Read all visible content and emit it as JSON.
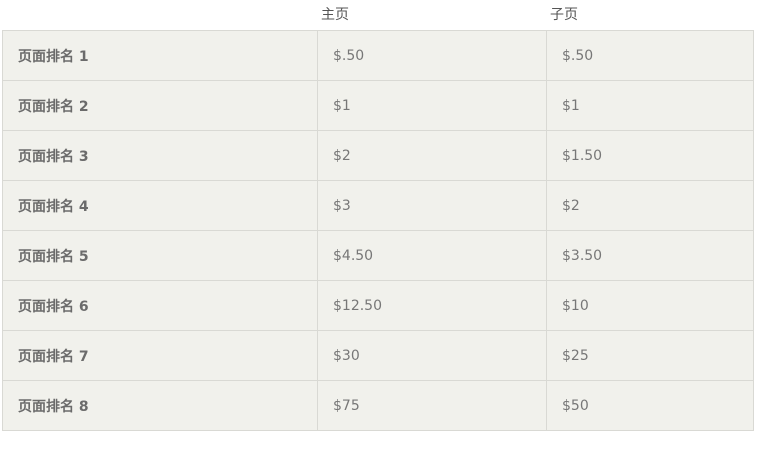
{
  "columns": {
    "main": "主页",
    "sub": "子页"
  },
  "rows": [
    {
      "rank": "页面排名 1",
      "main": "$.50",
      "sub": "$.50"
    },
    {
      "rank": "页面排名 2",
      "main": "$1",
      "sub": "$1"
    },
    {
      "rank": "页面排名 3",
      "main": "$2",
      "sub": "$1.50"
    },
    {
      "rank": "页面排名 4",
      "main": "$3",
      "sub": "$2"
    },
    {
      "rank": "页面排名 5",
      "main": "$4.50",
      "sub": "$3.50"
    },
    {
      "rank": "页面排名 6",
      "main": "$12.50",
      "sub": "$10"
    },
    {
      "rank": "页面排名 7",
      "main": "$30",
      "sub": "$25"
    },
    {
      "rank": "页面排名 8",
      "main": "$75",
      "sub": "$50"
    }
  ],
  "colors": {
    "table_background": "#f1f1ec",
    "border": "#d9d9d4",
    "text": "#777777"
  }
}
